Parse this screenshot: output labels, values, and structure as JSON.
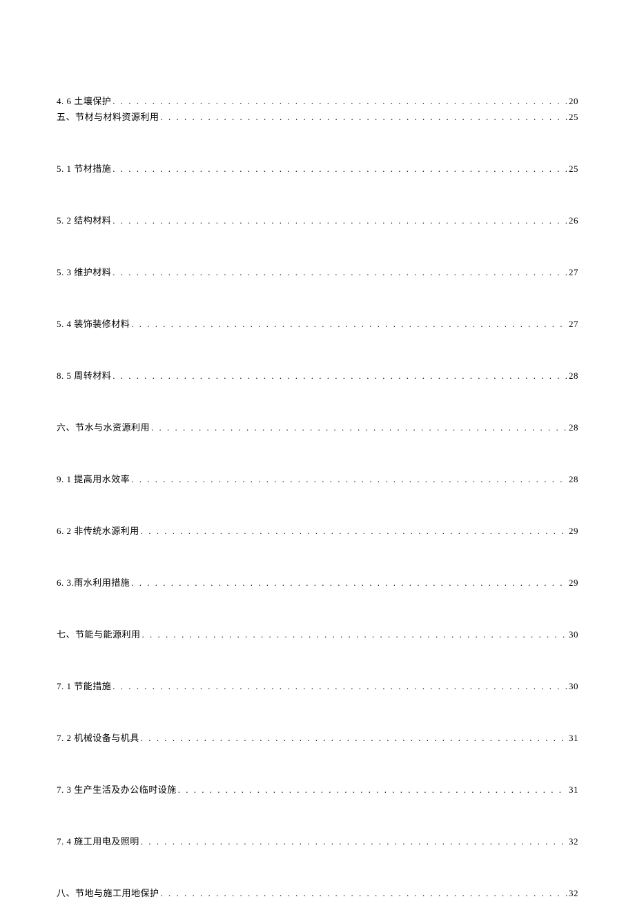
{
  "toc": [
    {
      "label": "4.  6 土壤保护",
      "page": "20",
      "gap": "small"
    },
    {
      "label": " 五、节材与材料资源利用",
      "page": "25",
      "gap": "large"
    },
    {
      "label": "5.  1 节材措施",
      "page": "25",
      "gap": "large"
    },
    {
      "label": "5.  2 结构材料",
      "page": "26",
      "gap": "large"
    },
    {
      "label": "5.  3 维护材料",
      "page": "27",
      "gap": "large"
    },
    {
      "label": "5.  4 装饰装修材料",
      "page": "27",
      "gap": "large"
    },
    {
      "label": "8.  5 周转材料",
      "page": "28",
      "gap": "large"
    },
    {
      "label": " 六、节水与水资源利用",
      "page": "28",
      "gap": "large"
    },
    {
      "label": "9.  1 提高用水效率",
      "page": "28",
      "gap": "large"
    },
    {
      "label": "6.  2 非传统水源利用",
      "page": "29",
      "gap": "large"
    },
    {
      "label": "6.  3.雨水利用措施",
      "page": "29",
      "gap": "large"
    },
    {
      "label": " 七、节能与能源利用",
      "page": "30",
      "gap": "large"
    },
    {
      "label": "7.  1 节能措施",
      "page": "30",
      "gap": "large"
    },
    {
      "label": "7.  2 机械设备与机具",
      "page": "31",
      "gap": "large"
    },
    {
      "label": "7.  3 生产生活及办公临时设施",
      "page": "31",
      "gap": "large"
    },
    {
      "label": "7.  4 施工用电及照明",
      "page": "32",
      "gap": "large"
    },
    {
      "label": " 八、节地与施工用地保护",
      "page": "32",
      "gap": "none"
    }
  ]
}
